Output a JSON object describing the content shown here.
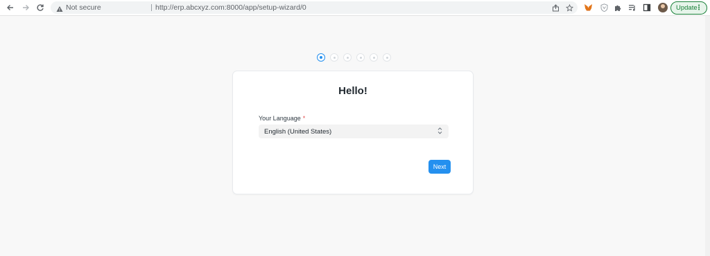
{
  "browser": {
    "security_label": "Not secure",
    "url": "http://erp.abcxyz.com:8000/app/setup-wizard/0",
    "update_label": "Update",
    "icons": [
      "back-icon",
      "forward-icon",
      "reload-icon",
      "warning-icon",
      "share-icon",
      "star-icon",
      "metamask-icon",
      "shield-icon",
      "puzzle-icon",
      "media-icon",
      "sidepanel-icon",
      "avatar",
      "menu-icon"
    ]
  },
  "wizard": {
    "steps": [
      {
        "state": "active"
      },
      {
        "state": "pending"
      },
      {
        "state": "pending"
      },
      {
        "state": "pending"
      },
      {
        "state": "pending"
      },
      {
        "state": "pending"
      }
    ],
    "title": "Hello!",
    "language_label": "Your Language",
    "required_mark": "*",
    "language_value": "English (United States)",
    "next_label": "Next"
  },
  "colors": {
    "accent": "#2490ef",
    "required": "#e24c4c",
    "update_green": "#188038"
  }
}
